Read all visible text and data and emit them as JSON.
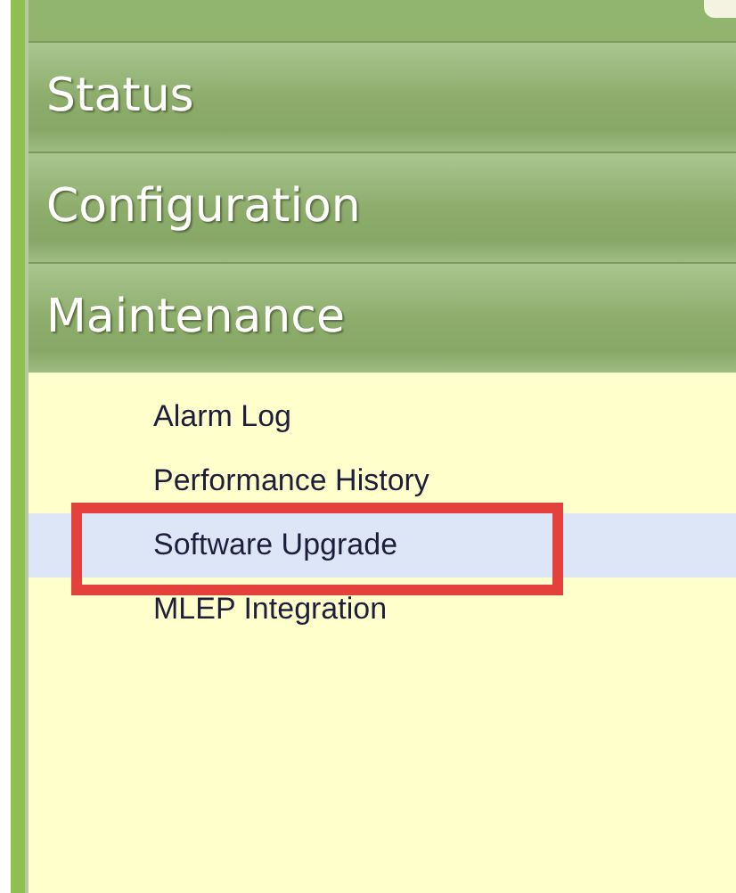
{
  "sections": [
    {
      "label": "Status"
    },
    {
      "label": "Configuration"
    },
    {
      "label": "Maintenance",
      "items": [
        {
          "label": "Alarm Log",
          "selected": false,
          "callout": false
        },
        {
          "label": "Performance History",
          "selected": false,
          "callout": false
        },
        {
          "label": "Software Upgrade",
          "selected": true,
          "callout": true
        },
        {
          "label": "MLEP Integration",
          "selected": false,
          "callout": false
        }
      ]
    }
  ]
}
